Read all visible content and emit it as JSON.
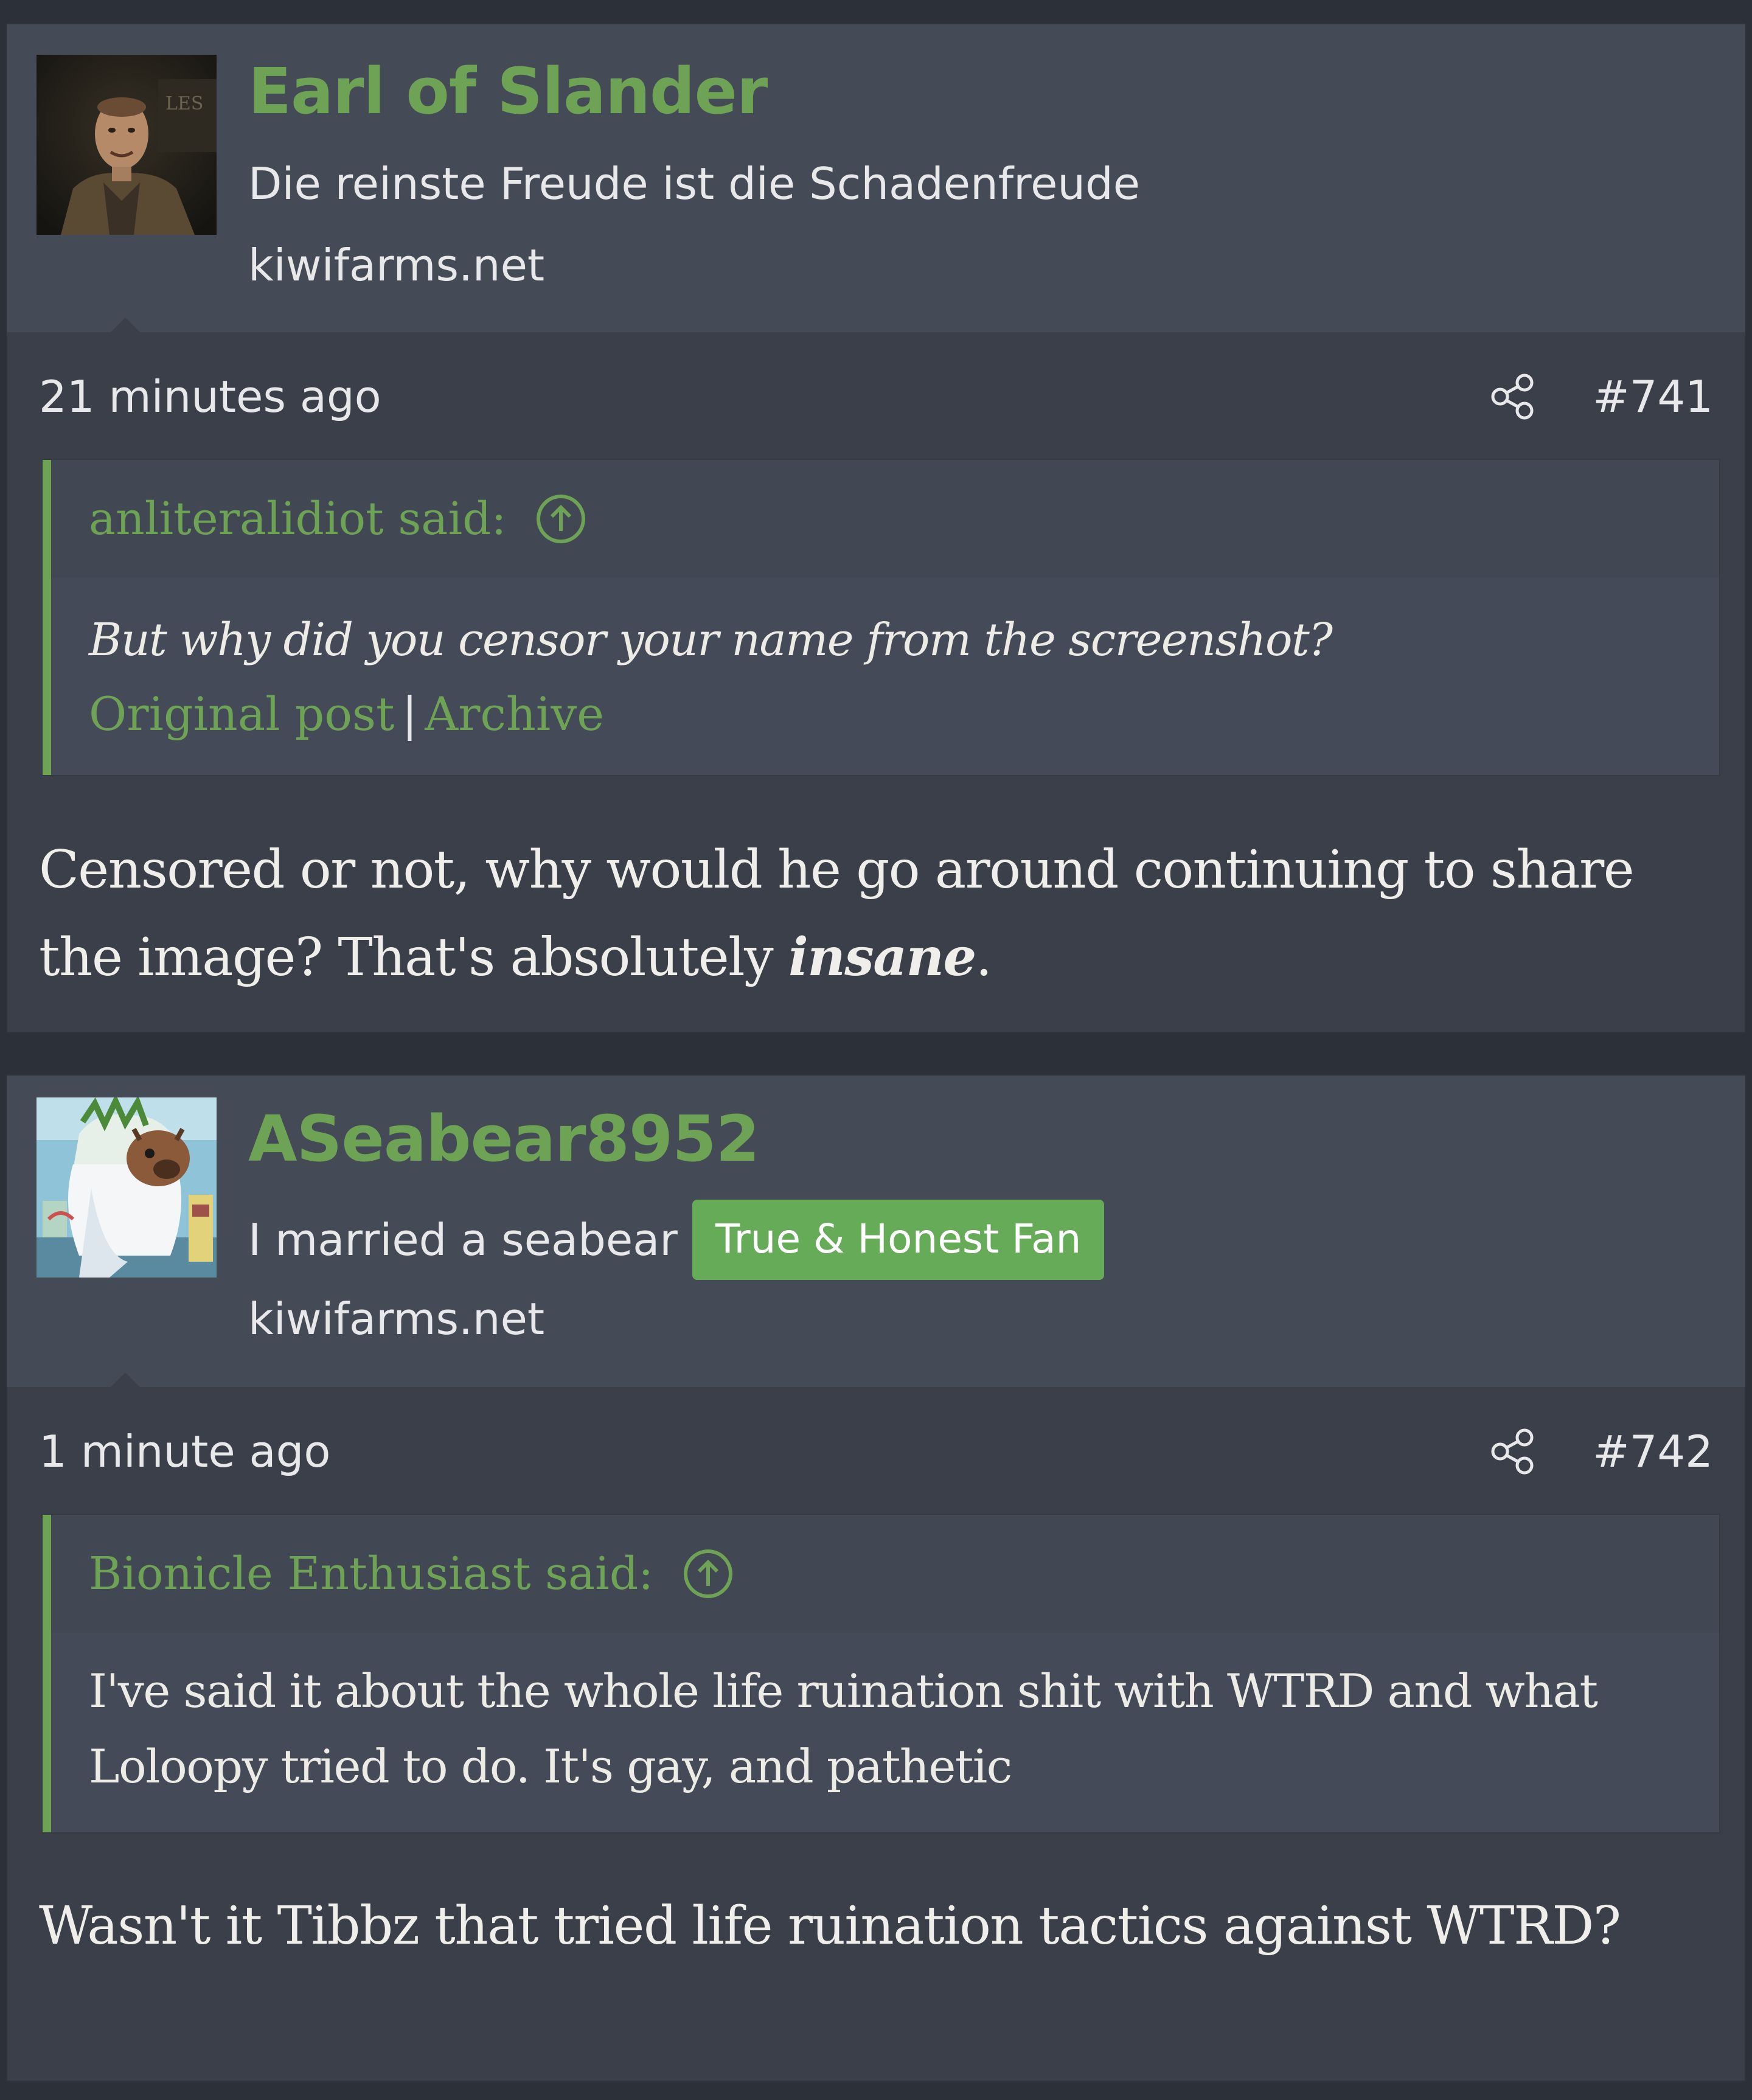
{
  "posts": [
    {
      "username": "Earl of Slander",
      "user_title": "Die reinste Freude ist die Schadenfreude",
      "site": "kiwifarms.net",
      "timestamp": "21 minutes ago",
      "post_number": "#741",
      "quote": {
        "author_line": "anliteralidiot said:",
        "text": "But why did you censor your name from the screenshot?",
        "link_original": "Original post",
        "link_separator": "|",
        "link_archive": "Archive"
      },
      "body_start": "Censored or not, why would he go around continuing to share the image? That's absolutely ",
      "body_emph": "insane",
      "body_end": "."
    },
    {
      "username": "ASeabear8952",
      "user_title": "I married a seabear",
      "badge": "True & Honest Fan",
      "site": "kiwifarms.net",
      "timestamp": "1 minute ago",
      "post_number": "#742",
      "quote": {
        "author_line": "Bionicle Enthusiast said:",
        "text": "I've said it about the whole life ruination shit with WTRD and what Loloopy tried to do. It's gay, and pathetic"
      },
      "body": "Wasn't it Tibbz that tried life ruination tactics against WTRD?"
    }
  ],
  "colors": {
    "page_background": "#2c3038",
    "post_background": "#3a3f4a",
    "header_background": "#444a56",
    "username_green": "#6ea254",
    "badge_green": "#66ac58",
    "text_light": "#e8e8ea"
  },
  "icons": {
    "share": "share-icon",
    "goto_quote": "arrow-up-circle-icon"
  }
}
